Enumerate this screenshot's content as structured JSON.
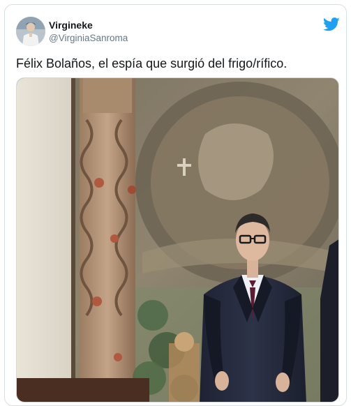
{
  "tweet": {
    "author": {
      "display_name": "Virgineke",
      "handle": "@VirginiaSanroma",
      "avatar_icon": "user-avatar"
    },
    "platform_icon": "twitter-bird-icon",
    "text": "Félix Bolaños, el espía que surgió del frigo/rífico.",
    "media": {
      "type": "photo",
      "icon": "photo-man-in-suit-before-tapestry"
    }
  },
  "colors": {
    "brand_blue": "#1da1f2",
    "text_primary": "#14171a",
    "text_secondary": "#657786",
    "border": "#d8dee2"
  }
}
